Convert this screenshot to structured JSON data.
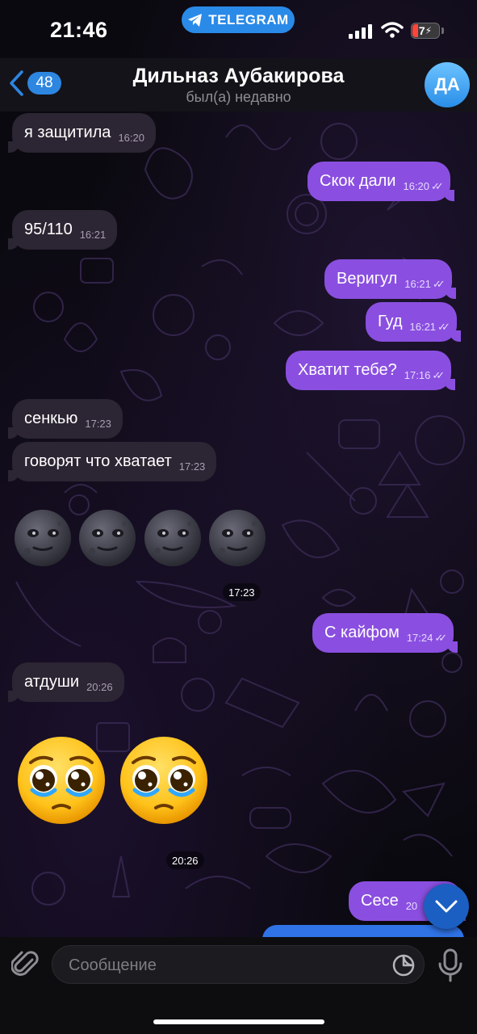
{
  "status_bar": {
    "time": "21:46",
    "app_pill": "TELEGRAM",
    "battery": "7"
  },
  "header": {
    "back_count": "48",
    "title": "Дильназ Аубакирова",
    "subtitle": "был(а) недавно",
    "avatar_initials": "ДА"
  },
  "messages": [
    {
      "dir": "in",
      "text": "я защитила",
      "time": "16:20"
    },
    {
      "dir": "out",
      "text": "Скок дали",
      "time": "16:20"
    },
    {
      "dir": "in",
      "text": "95/110",
      "time": "16:21"
    },
    {
      "dir": "out",
      "text": "Веригул",
      "time": "16:21"
    },
    {
      "dir": "out",
      "text": "Гуд",
      "time": "16:21"
    },
    {
      "dir": "out",
      "text": "Хватит тебе?",
      "time": "17:16"
    },
    {
      "dir": "in",
      "text": "сенкью",
      "time": "17:23"
    },
    {
      "dir": "in",
      "text": "говорят что хватает",
      "time": "17:23"
    },
    {
      "dir": "in",
      "type": "emoji",
      "emoji": "new-moon-face",
      "count": 4,
      "time": "17:23"
    },
    {
      "dir": "out",
      "text": "С кайфом",
      "time": "17:24"
    },
    {
      "dir": "in",
      "text": "атдуши",
      "time": "20:26"
    },
    {
      "dir": "in",
      "type": "emoji",
      "emoji": "pleading-face",
      "count": 2,
      "time": "20:26"
    },
    {
      "dir": "out",
      "text": "Сесе",
      "time": "20"
    }
  ],
  "input": {
    "placeholder": "Сообщение"
  },
  "colors": {
    "outgoing_bubble": "#8a4fe0",
    "incoming_bubble": "#2c2533",
    "accent": "#2d86e0",
    "background": "#0a090f"
  },
  "icons": [
    "back-chevron-icon",
    "attach-icon",
    "sticker-icon",
    "mic-icon",
    "chevron-down-icon",
    "telegram-icon",
    "signal-icon",
    "wifi-icon",
    "battery-icon",
    "read-ticks-icon"
  ]
}
